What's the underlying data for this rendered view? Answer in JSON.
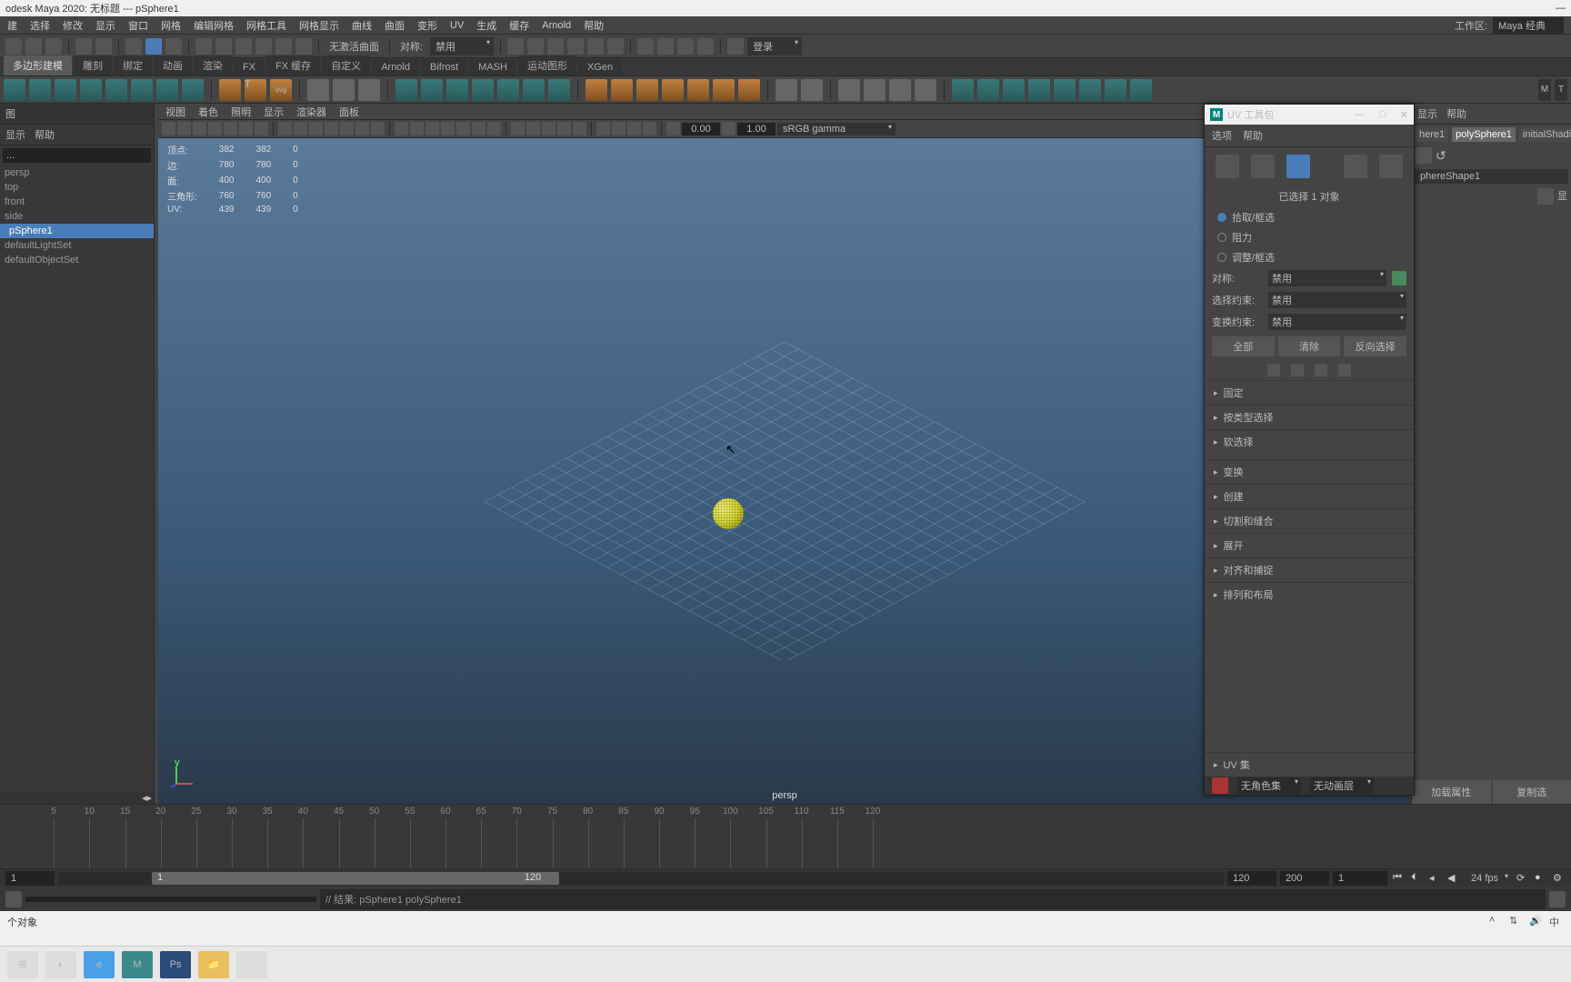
{
  "title": "odesk Maya 2020: 无标题 --- pSphere1",
  "mainMenu": {
    "items": [
      "建",
      "选择",
      "修改",
      "显示",
      "窗口",
      "网格",
      "编辑网格",
      "网格工具",
      "网格显示",
      "曲线",
      "曲面",
      "变形",
      "UV",
      "生成",
      "缓存",
      "Arnold",
      "帮助"
    ],
    "workspaceLabel": "工作区:",
    "workspace": "Maya 经典"
  },
  "toolbar": {
    "noActive": "无激活曲面",
    "symLabel": "对称:",
    "symValue": "禁用",
    "login": "登录"
  },
  "shelfTabs": [
    "多边形建模",
    "雕刻",
    "绑定",
    "动画",
    "渲染",
    "FX",
    "FX 缓存",
    "自定义",
    "Arnold",
    "Bifrost",
    "MASH",
    "运动图形",
    "XGen"
  ],
  "outliner": {
    "header": "图",
    "menu": [
      "显示",
      "帮助"
    ],
    "searchPlaceholder": "...",
    "items": [
      "persp",
      "top",
      "front",
      "side"
    ],
    "selected": "pSphere1",
    "sets": [
      "defaultLightSet",
      "defaultObjectSet"
    ]
  },
  "viewport": {
    "menu": [
      "视图",
      "着色",
      "照明",
      "显示",
      "渲染器",
      "面板"
    ],
    "val1": "0.00",
    "val2": "1.00",
    "colorspace": "sRGB gamma",
    "camera": "persp",
    "hud": [
      {
        "l": "顶点:",
        "a": "382",
        "b": "382",
        "c": "0"
      },
      {
        "l": "边:",
        "a": "780",
        "b": "780",
        "c": "0"
      },
      {
        "l": "面:",
        "a": "400",
        "b": "400",
        "c": "0"
      },
      {
        "l": "三角形:",
        "a": "760",
        "b": "760",
        "c": "0"
      },
      {
        "l": "UV:",
        "a": "439",
        "b": "439",
        "c": "0"
      }
    ]
  },
  "uvToolkit": {
    "title": "UV 工具包",
    "menu": [
      "选项",
      "帮助"
    ],
    "selStatus": "已选择 1 对象",
    "radios": {
      "r1": "拾取/框选",
      "r2": "阻力",
      "r3": "调整/框选"
    },
    "sym": {
      "label": "对称:",
      "value": "禁用"
    },
    "selConst": {
      "label": "选择约束:",
      "value": "禁用"
    },
    "transConst": {
      "label": "变换约束:",
      "value": "禁用"
    },
    "btns": {
      "a": "全部",
      "b": "清除",
      "c": "反向选择"
    },
    "sections": [
      "固定",
      "按类型选择",
      "软选择",
      "变换",
      "创建",
      "切割和缝合",
      "展开",
      "对齐和捕捉",
      "排列和布局"
    ],
    "footer": "UV 集",
    "cs1": "无角色集",
    "cs2": "无动画层"
  },
  "rightPanel": {
    "menu": [
      "显示",
      "帮助"
    ],
    "tabs": [
      "here1",
      "polySphere1",
      "initialShading"
    ],
    "shapeTab": "phereShape1",
    "btn1": "加载属性",
    "btn2": "复制选"
  },
  "timeline": {
    "start": "1",
    "sliderStart": "1",
    "sliderEnd": "120",
    "end": "120",
    "max": "200",
    "current": "1",
    "fps": "24 fps"
  },
  "cmd": {
    "result": "// 结果: pSphere1 polySphere1"
  },
  "status": "个对象"
}
